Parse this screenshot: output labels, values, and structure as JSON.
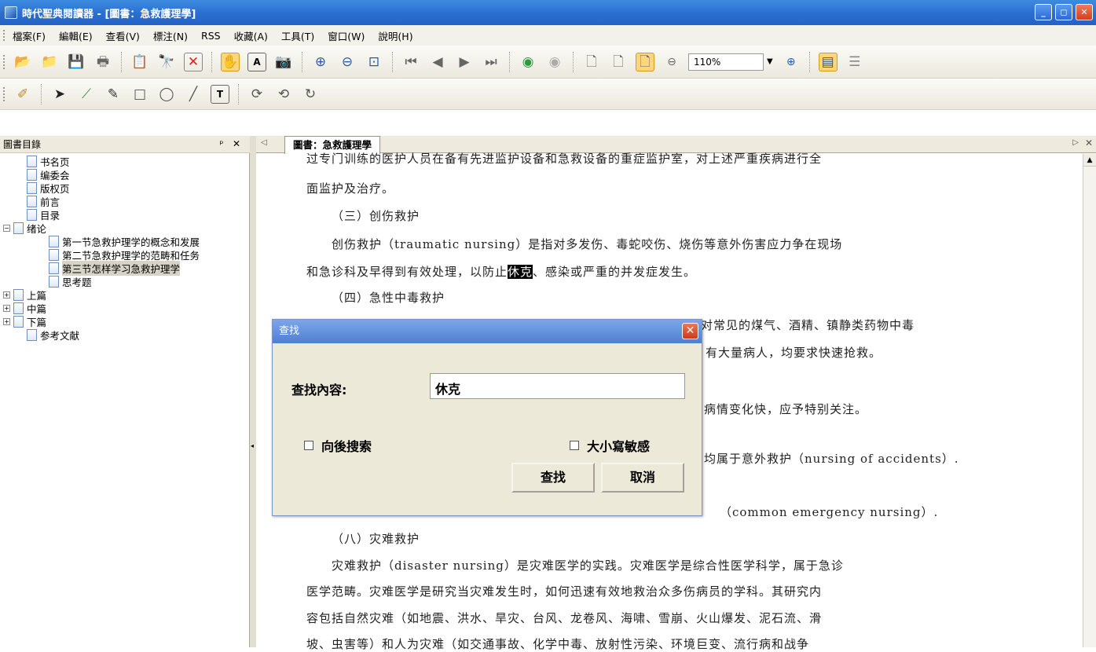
{
  "window": {
    "title": "時代聖典閱讀器 - [圖書：急救護理學]",
    "minimize": "_",
    "maximize": "◻",
    "close": "✕"
  },
  "menu": [
    "檔案(F)",
    "編輯(E)",
    "查看(V)",
    "標注(N)",
    "RSS",
    "收藏(A)",
    "工具(T)",
    "窗口(W)",
    "說明(H)"
  ],
  "toolbar": {
    "zoom": "110%"
  },
  "sidebar": {
    "title": "圖書目錄",
    "pin": "ᵖ",
    "close": "✕",
    "items": [
      "书名页",
      "编委会",
      "版权页",
      "前言",
      "目录",
      "绪论",
      "第一节急救护理学的概念和发展",
      "第二节急救护理学的范畴和任务",
      "第三节怎样学习急救护理学",
      "思考题",
      "上篇",
      "中篇",
      "下篇",
      "参考文献"
    ]
  },
  "tab": {
    "label": "圖書：急救護理學"
  },
  "content": {
    "lines": [
      "过专门训练的医护人员在备有先进监护设备和急救设备的重症监护室，对上述严重疾病进行全",
      "面监护及治疗。",
      "（三）创伤救护",
      "创伤救护（traumatic nursing）是指对多发伤、毒蛇咬伤、烧伤等意外伤害应力争在现场",
      "和急诊科及早得到有效处理，以防止",
      "休克",
      "、感染或严重的并发症发生。",
      "（四）急性中毒救护",
      "括对常见的煤气、酒精、镇静类药物中毒",
      "有大量病人，均要求快速抢救。",
      "病情变化快，应予特别关注。",
      "均属于意外救护（nursing of accidents）.",
      "（common emergency nursing）.",
      "（八）灾难救护",
      "灾难救护（disaster nursing）是灾难医学的实践。灾难医学是综合性医学科学，属于急诊",
      "医学范畴。灾难医学是研究当灾难发生时，如何迅速有效地救治众多伤病员的学科。其研究内",
      "容包括自然灾难（如地震、洪水、旱灾、台风、龙卷风、海啸、雪崩、火山爆发、泥石流、滑",
      "坡、虫害等）和人为灾难（如交通事故、化学中毒、放射性污染、环境巨变、流行病和战争"
    ]
  },
  "dialog": {
    "title": "查找",
    "close": "✕",
    "find_label": "查找內容:",
    "find_value": "休克",
    "search_back": "向後搜索",
    "match_case": "大小寫敏感",
    "find_button": "查找",
    "cancel_button": "取消"
  }
}
